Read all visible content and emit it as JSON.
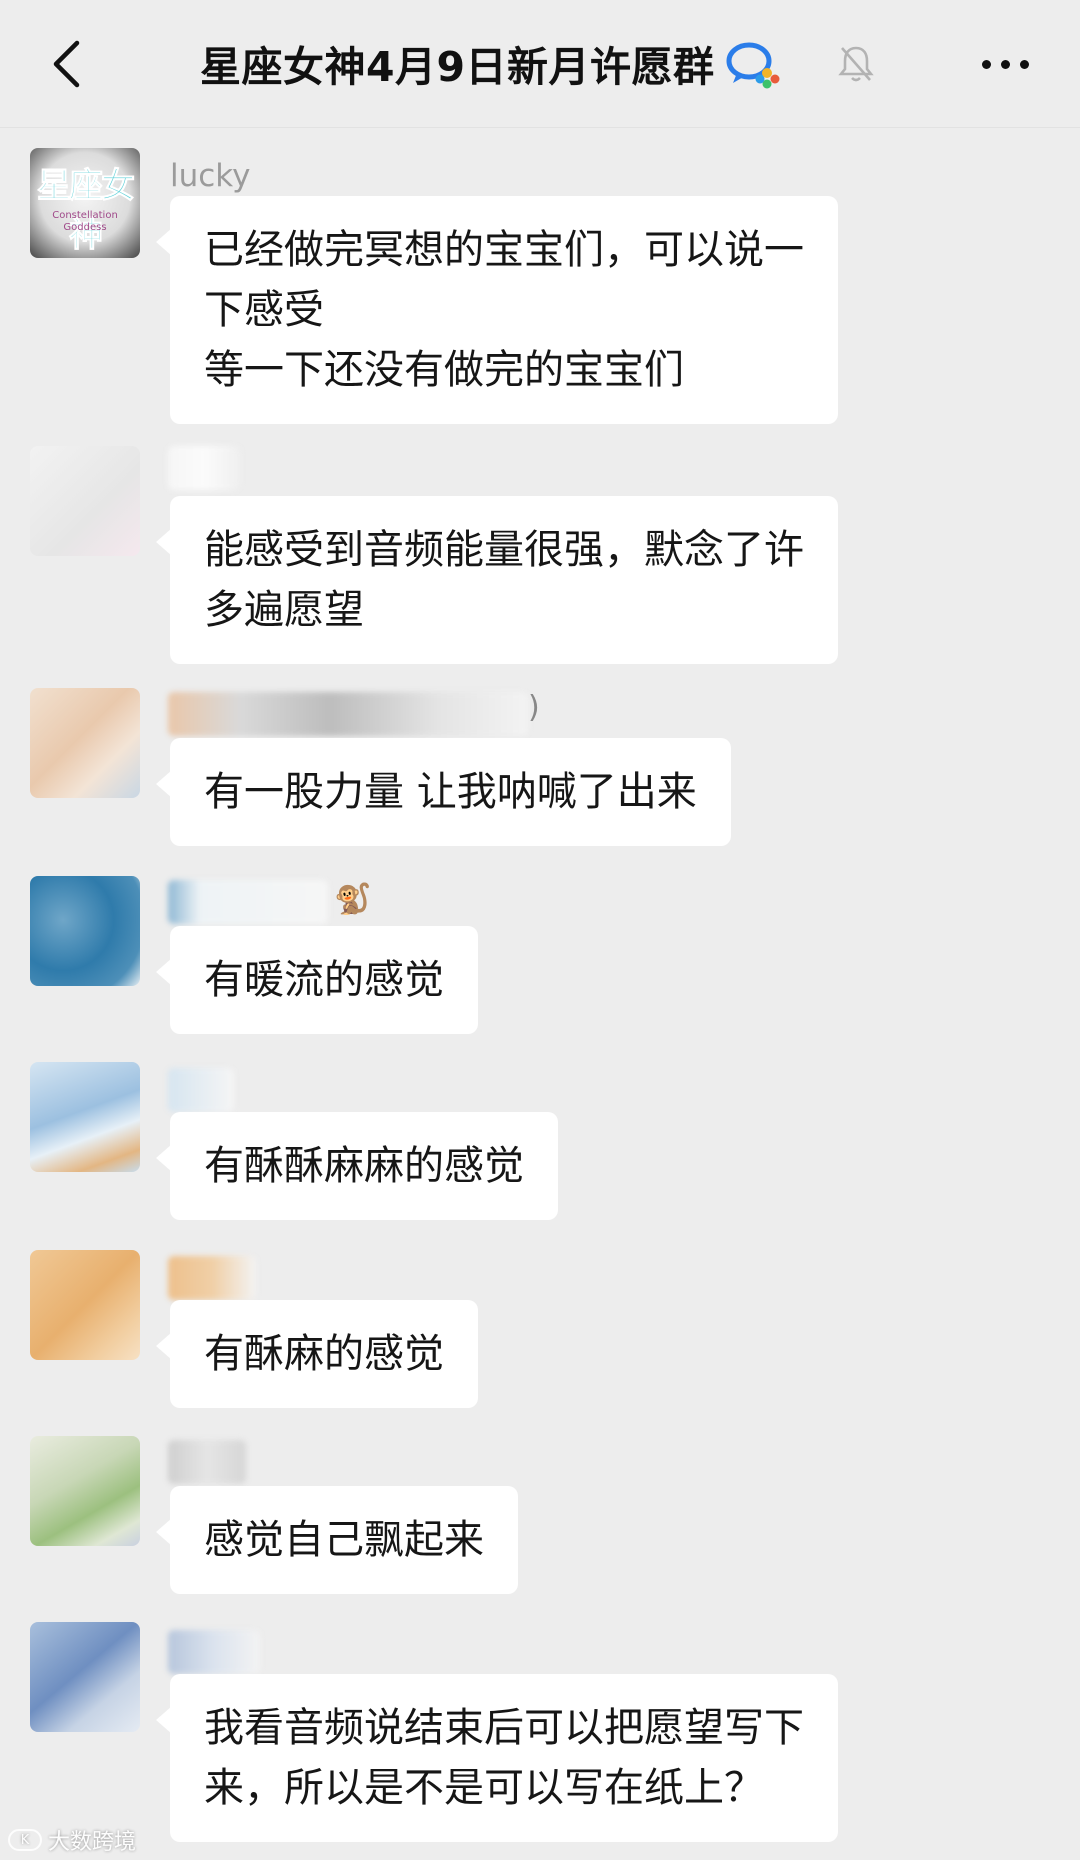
{
  "header": {
    "title": "星座女神4月9日新月许愿群",
    "back_icon": "chevron-left-icon",
    "group_type_icon": "wecom-icon",
    "mute_icon": "bell-off-icon",
    "more_icon": "more-dots-icon"
  },
  "messages": [
    {
      "sender": "lucky",
      "avatar": {
        "brand": "星座女神",
        "line1": "Constellation",
        "line2": "Goddess"
      },
      "text": "已经做完冥想的宝宝们，可以说一\n下感受\n等一下还没有做完的宝宝们"
    },
    {
      "sender": "",
      "text": "能感受到音频能量很强，默念了许\n多遍愿望"
    },
    {
      "sender": "",
      "sender_suffix": ")",
      "text": "有一股力量 让我呐喊了出来"
    },
    {
      "sender": "",
      "sender_emoji": "🐒",
      "text": "有暖流的感觉"
    },
    {
      "sender": "",
      "text": "有酥酥麻麻的感觉"
    },
    {
      "sender": "",
      "text": "有酥麻的感觉"
    },
    {
      "sender": "",
      "text": "感觉自己飘起来"
    },
    {
      "sender": "",
      "text": "我看音频说结束后可以把愿望写下\n来，所以是不是可以写在纸上？"
    }
  ],
  "watermark": {
    "logo": "K",
    "text": "大数跨境"
  },
  "colors": {
    "background": "#ededed",
    "bubble": "#ffffff",
    "text": "#161616",
    "sender": "#9b9b9b"
  }
}
